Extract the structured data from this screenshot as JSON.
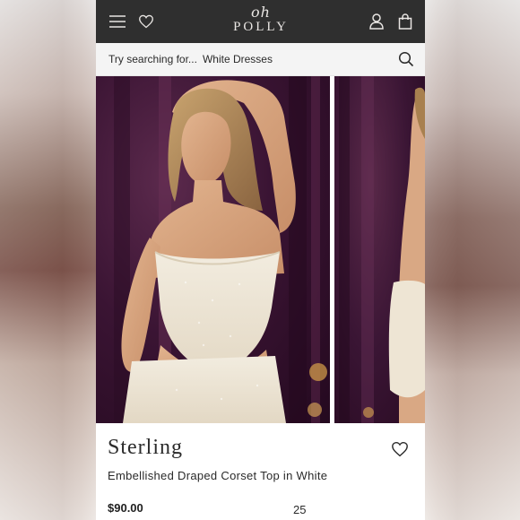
{
  "header": {
    "logo_top": "oh",
    "logo_bottom": "POLLY",
    "icons": [
      "menu-icon",
      "heart-icon",
      "account-icon",
      "bag-icon"
    ],
    "bar_color": "#2f2f2f"
  },
  "search": {
    "prompt": "Try searching for...",
    "suggestion": "White Dresses",
    "icon": "search-icon"
  },
  "product": {
    "brand_name": "Sterling",
    "name": "Embellished Draped Corset Top in White",
    "price": "$90.00",
    "count": "25",
    "wishlist_icon": "heart-outline-icon"
  },
  "colors": {
    "curtain": "#3a1433",
    "top_fabric": "#efe7d8"
  }
}
